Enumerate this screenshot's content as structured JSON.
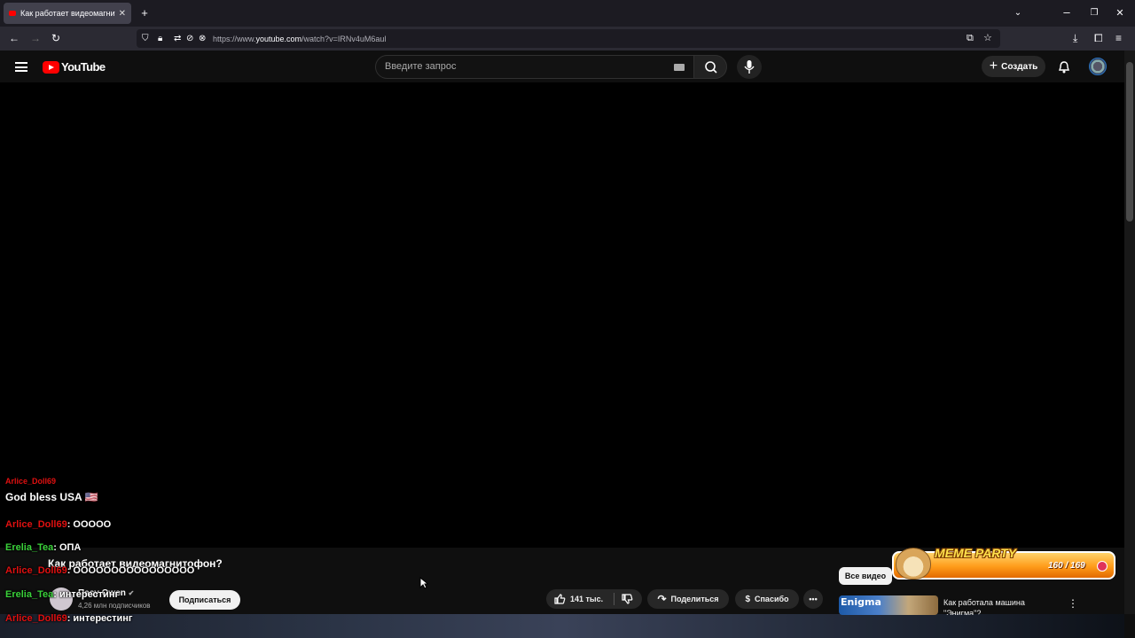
{
  "browser": {
    "tab_title": "Как работает видеомагнитоф",
    "url_prefix": "https://www.",
    "url_host": "youtube.com",
    "url_path": "/watch?v=IRNv4uM6aul"
  },
  "youtube": {
    "logo_text": "YouTube",
    "search_placeholder": "Введите запрос",
    "create_label": "Создать"
  },
  "video": {
    "title": "Как работает видеомагнитофон?",
    "channel_name": "Пасу Owen",
    "subscribers": "4,26 млн подписчиков",
    "subscribe_label": "Подписаться",
    "likes": "141 тыс.",
    "share_label": "Поделиться",
    "thanks_label": "Спасибо"
  },
  "sidebar": {
    "all_videos_label": "Все видео",
    "rec_thumb_text": "Enigma",
    "rec_title": "Как работала машина \"Энигма\"?"
  },
  "overlay": {
    "meme_title": "MEME PARTY",
    "meme_count": "160 / 169",
    "chat": [
      {
        "user": "Arlice_Doll69",
        "text": "",
        "color": "red"
      },
      {
        "user": "",
        "text": "God bless USA 🇺🇸",
        "color": "white"
      },
      {
        "user": "Arlice_Doll69",
        "text": ": OOOOO",
        "color": "red"
      },
      {
        "user": "Erelia_Tea",
        "text": ": ОПА",
        "color": "green"
      },
      {
        "user": "Arlice_Doll69",
        "text": ": OOOOOOOOOOOOOOOO",
        "color": "red"
      },
      {
        "user": "Erelia_Tea",
        "text": ": интерестинг",
        "color": "green"
      },
      {
        "user": "Arlice_Doll69",
        "text": ": интерестинг",
        "color": "red"
      }
    ]
  },
  "colors": {
    "yt_red": "#ff0000",
    "chat_red_user": "#e01010",
    "chat_green_user": "#3ad13a"
  }
}
